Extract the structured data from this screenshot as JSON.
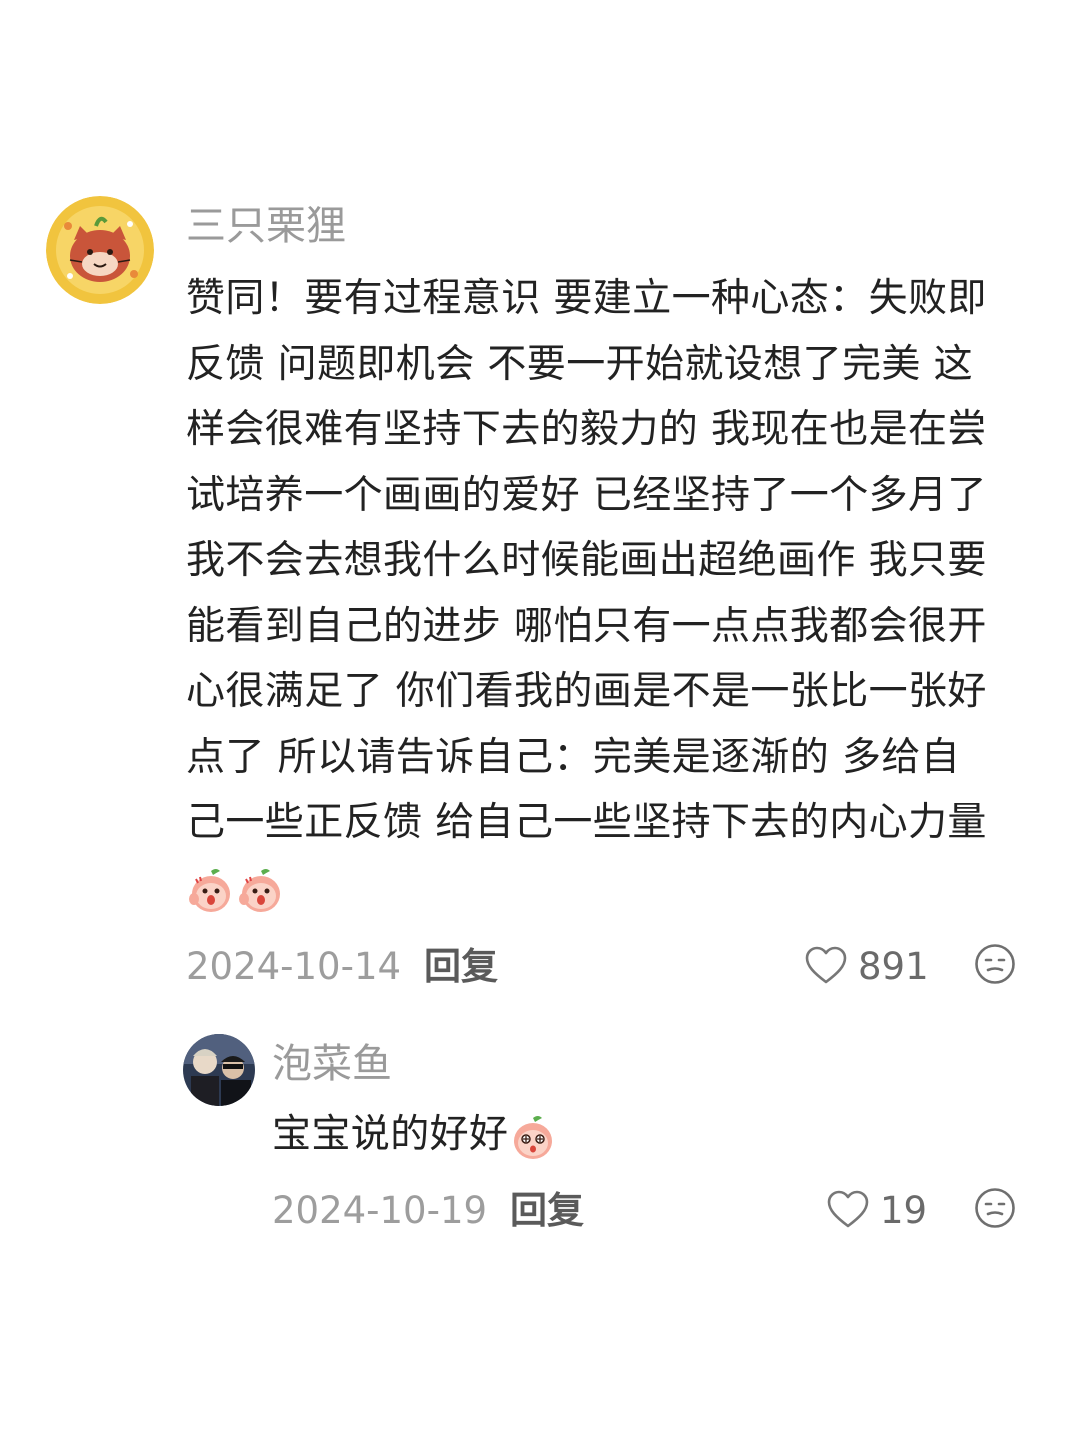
{
  "comments": [
    {
      "username": "三只栗狸",
      "lines": [
        "赞同！要有过程意识 要建立一种心态：失败即",
        "反馈 问题即机会 不要一开始就设想了完美 这",
        "样会很难有坚持下去的毅力的 我现在也是在尝",
        "试培养一个画画的爱好 已经坚持了一个多月了",
        "我不会去想我什么时候能画出超绝画作 我只要",
        "能看到自己的进步 哪怕只有一点点我都会很开",
        "心很满足了 你们看我的画是不是一张比一张好",
        "点了 所以请告诉自己：完美是逐渐的 多给自",
        "己一些正反馈 给自己一些坚持下去的内心力量"
      ],
      "trailing_emojis": [
        "peach-surprised-emoji",
        "peach-surprised-emoji"
      ],
      "date": "2024-10-14",
      "reply_label": "回复",
      "like_count": "891",
      "avatar_icon": "tiger-avatar-icon"
    },
    {
      "username": "泡菜鱼",
      "text": "宝宝说的好好",
      "trailing_emojis": [
        "peach-dazzled-emoji"
      ],
      "date": "2024-10-19",
      "reply_label": "回复",
      "like_count": "19",
      "avatar_icon": "photo-avatar"
    }
  ],
  "colors": {
    "username": "#9a9a9a",
    "body": "#222222",
    "meta": "#9d9d9d",
    "reply": "#5a5a5a",
    "avatar_gold": "#f1c43e",
    "peach": "#f6a99a"
  },
  "icons": {
    "like": "heart-outline-icon",
    "dislike": "meh-face-icon"
  }
}
